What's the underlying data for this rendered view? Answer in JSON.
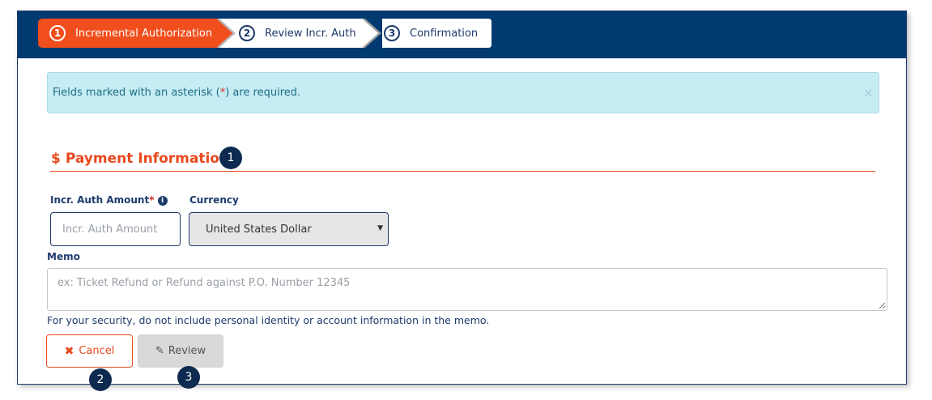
{
  "stepper": {
    "steps": [
      {
        "number": "1",
        "label": "Incremental Authorization"
      },
      {
        "number": "2",
        "label": "Review Incr. Auth"
      },
      {
        "number": "3",
        "label": "Confirmation"
      }
    ]
  },
  "alert": {
    "text_before": "Fields marked with an asterisk (",
    "asterisk": "*",
    "text_after": ") are required.",
    "close": "×"
  },
  "section": {
    "icon": "$",
    "title": "Payment Information"
  },
  "callouts": [
    "1",
    "2",
    "3"
  ],
  "form": {
    "amount_label": "Incr. Auth Amount",
    "amount_required": "*",
    "amount_info": "i",
    "amount_placeholder": "Incr. Auth Amount",
    "currency_label": "Currency",
    "currency_value": "United States Dollar",
    "memo_label": "Memo",
    "memo_placeholder": "ex: Ticket Refund or Refund against P.O. Number 12345",
    "helper_text": "For your security, do not include personal identity or account information in the memo."
  },
  "buttons": {
    "cancel_icon": "✖",
    "cancel_label": "Cancel",
    "review_icon": "✎",
    "review_label": "Review"
  },
  "colors": {
    "navy": "#003a70",
    "accent_orange": "#e8491d",
    "alert_bg": "#c6ecf4"
  }
}
